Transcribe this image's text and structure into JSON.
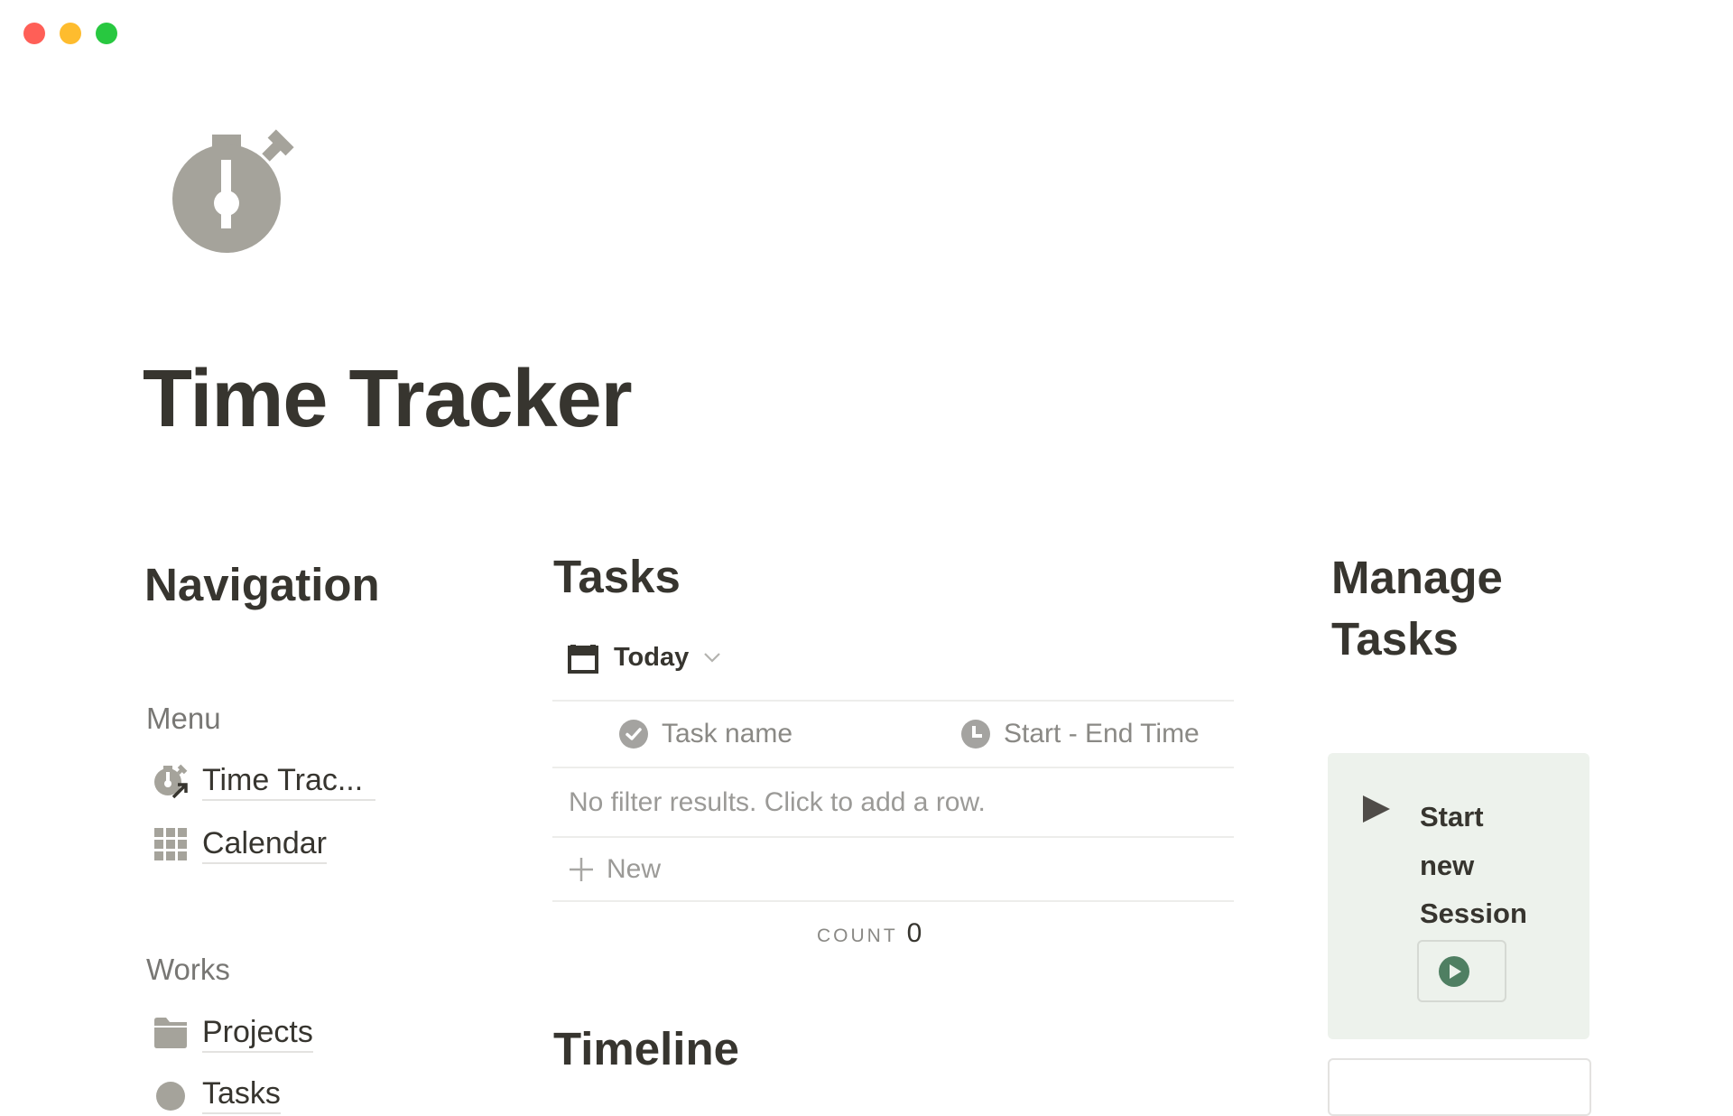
{
  "window": {
    "traffic_lights": {
      "close": "#FF5F57",
      "minimize": "#FEBC2E",
      "maximize": "#28C840"
    }
  },
  "page": {
    "icon": "stopwatch-icon",
    "title": "Time Tracker"
  },
  "navigation": {
    "heading": "Navigation",
    "sections": [
      {
        "label": "Menu",
        "items": [
          {
            "label": "Time Trac...",
            "icon": "stopwatch-link-icon"
          },
          {
            "label": "Calendar",
            "icon": "grid-icon"
          }
        ]
      },
      {
        "label": "Works",
        "items": [
          {
            "label": "Projects",
            "icon": "folder-icon"
          },
          {
            "label": "Tasks",
            "icon": "circle-icon"
          }
        ]
      }
    ]
  },
  "tasks": {
    "heading": "Tasks",
    "view": {
      "label": "Today",
      "icon": "calendar-icon"
    },
    "columns": [
      {
        "label": "Task name",
        "icon": "check-circle-icon"
      },
      {
        "label": "Start - End Time",
        "icon": "clock-icon"
      }
    ],
    "empty_message": "No filter results. Click to add a row.",
    "new_label": "New",
    "count_label": "COUNT",
    "count_value": "0"
  },
  "timeline": {
    "heading": "Timeline"
  },
  "manage": {
    "heading_line1": "Manage",
    "heading_line2": "Tasks",
    "session_card": {
      "title_lines": [
        "Start",
        "new",
        "Session"
      ],
      "accent": "#4F7F62"
    }
  }
}
